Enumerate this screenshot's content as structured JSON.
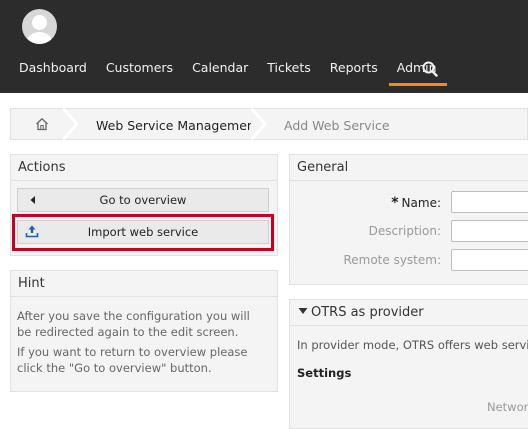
{
  "nav": {
    "items": [
      {
        "label": "Dashboard"
      },
      {
        "label": "Customers"
      },
      {
        "label": "Calendar"
      },
      {
        "label": "Tickets"
      },
      {
        "label": "Reports"
      },
      {
        "label": "Admin",
        "active": true
      }
    ]
  },
  "breadcrumb": {
    "items": [
      {
        "label": "Web Service Management"
      },
      {
        "label": "Add Web Service"
      }
    ]
  },
  "actions": {
    "title": "Actions",
    "go_to_overview": "Go to overview",
    "import_web_service": "Import web service"
  },
  "hint": {
    "title": "Hint",
    "line1": "After you save the configuration you will be redirected again to the edit screen.",
    "line2": "If you want to return to overview please click the \"Go to overview\" button."
  },
  "general": {
    "title": "General",
    "name_label": "Name:",
    "required_marker": "*",
    "description_label": "Description:",
    "remote_system_label": "Remote system:",
    "name_value": "",
    "description_value": "",
    "remote_system_value": ""
  },
  "provider": {
    "title": "OTRS as provider",
    "description": "In provider mode, OTRS offers web services",
    "settings_label": "Settings",
    "network_label": "Networ"
  },
  "colors": {
    "topbar": "#2c2c2c",
    "accent": "#f08a24",
    "highlight": "#c8001e",
    "panel": "#f4f4f4",
    "import_icon": "#1d5fa8"
  }
}
